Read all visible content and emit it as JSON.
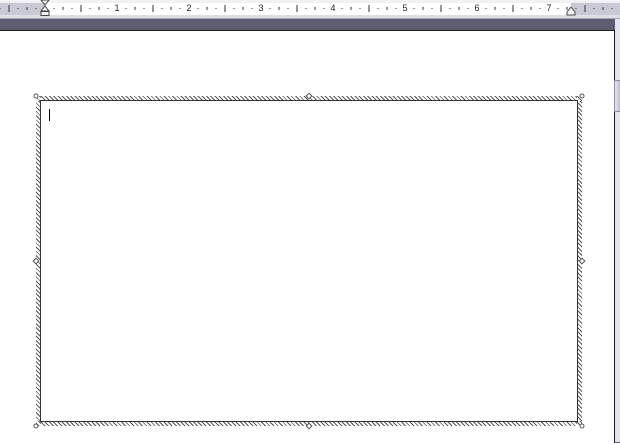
{
  "ruler": {
    "numbers": [
      "1",
      "2",
      "3",
      "4",
      "5",
      "6",
      "7"
    ]
  },
  "document": {
    "text_box_content": ""
  },
  "colors": {
    "workspace": "#5d5d72",
    "page": "#ffffff",
    "ruler_background": "#dcdce4"
  },
  "icons": {
    "first_line_indent": "hourglass-indent-marker",
    "right_indent": "triangle-indent-marker"
  }
}
